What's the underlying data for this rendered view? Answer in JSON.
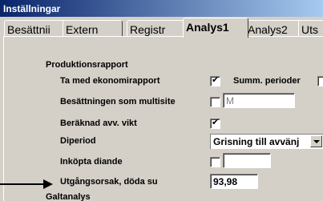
{
  "window": {
    "title": "Inställningar"
  },
  "tabs": [
    {
      "label": "Besättnii"
    },
    {
      "label": "Extern"
    },
    {
      "label": "Registr"
    },
    {
      "label": "Analys1",
      "active": true
    },
    {
      "label": "Analys2"
    },
    {
      "label": "Uts"
    }
  ],
  "sections": {
    "produktion": "Produktionsrapport",
    "galt": "Galtanalys"
  },
  "rows": {
    "ta_med": {
      "label": "Ta med ekonomirapport",
      "checked": true
    },
    "summ": {
      "label": "Summ. perioder",
      "checked": false
    },
    "multisite": {
      "label": "Besättningen som multisite",
      "checked": false,
      "value": "M"
    },
    "avv_vikt": {
      "label": "Beräknad avv. vikt",
      "checked": true
    },
    "diperiod": {
      "label": "Diperiod",
      "selected": "Grisning till avvänj"
    },
    "inkopta": {
      "label": "Inköpta diande",
      "checked": false,
      "value": ""
    },
    "utgangsorsak": {
      "label": "Utgångsorsak, döda su",
      "value": "93,98"
    }
  },
  "colors": {
    "titlebar_start": "#0a246a",
    "titlebar_end": "#a6caf0",
    "face": "#d4d0c8"
  }
}
